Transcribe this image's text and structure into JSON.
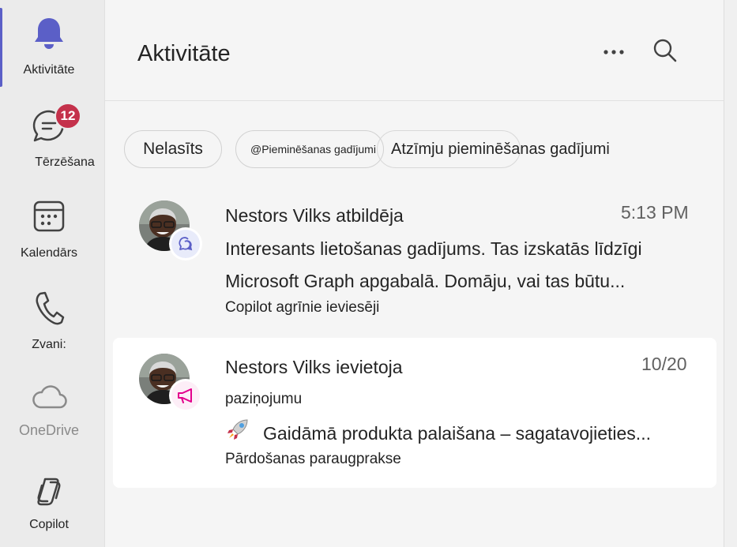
{
  "rail": {
    "items": [
      {
        "label": "Aktivitāte",
        "icon": "bell-icon"
      },
      {
        "label": "Tērzēšana",
        "icon": "chat-icon",
        "badge": "12"
      },
      {
        "label": "Kalendārs",
        "icon": "calendar-icon"
      },
      {
        "label": "Zvani:",
        "icon": "phone-icon"
      },
      {
        "label": "OneDrive",
        "icon": "cloud-icon"
      },
      {
        "label": "Copilot",
        "icon": "copilot-icon"
      }
    ]
  },
  "header": {
    "title": "Aktivitāte",
    "more_icon": "more-options-icon",
    "search_icon": "search-icon"
  },
  "filters": [
    {
      "label": "Nelasīts"
    },
    {
      "label": "@Pieminēšanas gadījumi"
    },
    {
      "label": "Atzīmju pieminēšanas gadījumi"
    }
  ],
  "feed": [
    {
      "title": "Nestors Vilks atbildēja",
      "time": "5:13 PM",
      "line1": "Interesants lietošanas gadījums. Tas izskatās līdzīgi",
      "line2": "Microsoft Graph apgabalā. Domāju, vai tas būtu...",
      "channel": "Copilot agrīnie ieviesēji",
      "badge_icon": "reply-icon"
    },
    {
      "title": "Nestors Vilks ievietoja",
      "time": "10/20",
      "subtitle": "paziņojumu",
      "line1": "Gaidāmā produkta palaišana – sagatavojieties...",
      "line1_icon": "rocket-icon",
      "channel": "Pārdošanas paraugprakse",
      "badge_icon": "megaphone-icon"
    }
  ],
  "colors": {
    "accent": "#5b5fc7",
    "badge": "#c4314b",
    "announcement": "#e3008c"
  }
}
